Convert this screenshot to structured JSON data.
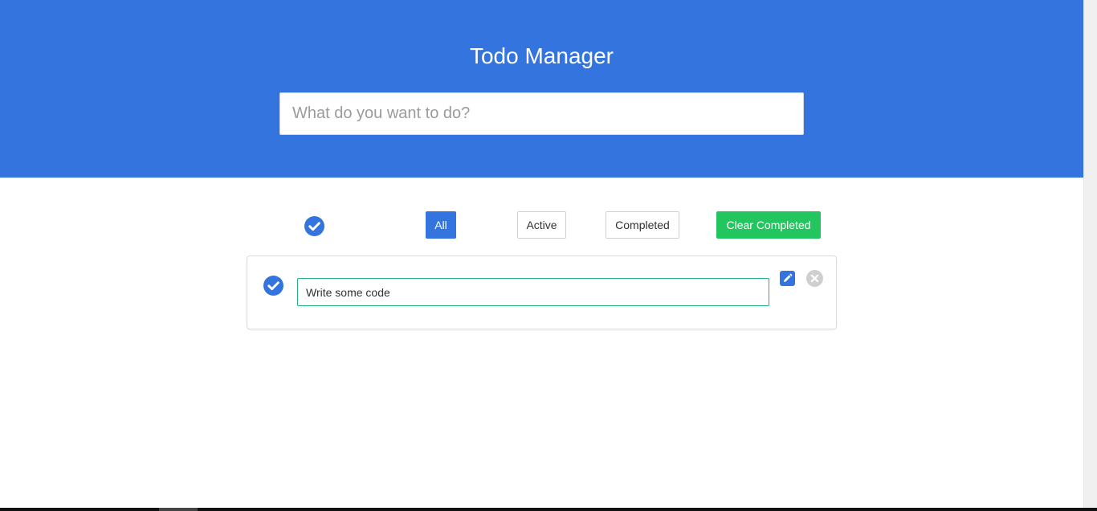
{
  "header": {
    "title": "Todo Manager",
    "new_todo_placeholder": "What do you want to do?"
  },
  "filters": {
    "toggle_all_icon": "check-circle-icon",
    "all_label": "All",
    "active_label": "Active",
    "completed_label": "Completed",
    "clear_completed_label": "Clear Completed",
    "selected": "All"
  },
  "todos": [
    {
      "text": "Write some code",
      "completed": true,
      "editing": true,
      "check_icon": "check-circle-icon",
      "edit_icon": "pencil-icon",
      "delete_icon": "close-circle-icon"
    }
  ],
  "colors": {
    "header_bg": "#3474de",
    "primary": "#3474de",
    "clear_button": "#23c55e",
    "edit_focus_border": "#1fb57a",
    "delete_icon": "#cfcfcf"
  }
}
